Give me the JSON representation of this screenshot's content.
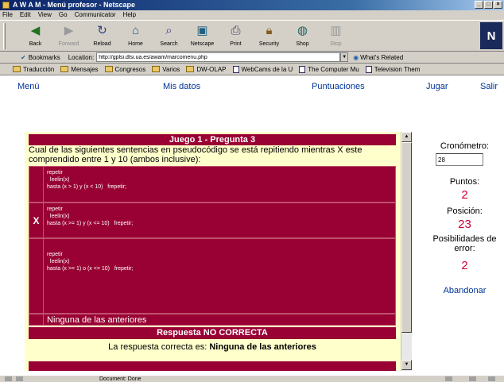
{
  "window": {
    "title": "A W A M - Menú profesor - Netscape"
  },
  "menu": [
    "File",
    "Edit",
    "View",
    "Go",
    "Communicator",
    "Help"
  ],
  "toolbar": [
    {
      "label": "Back",
      "icon": "back-arrow-icon",
      "enabled": true
    },
    {
      "label": "Forward",
      "icon": "forward-arrow-icon",
      "enabled": false
    },
    {
      "label": "Reload",
      "icon": "reload-icon",
      "enabled": true
    },
    {
      "label": "Home",
      "icon": "home-icon",
      "enabled": true
    },
    {
      "label": "Search",
      "icon": "search-icon",
      "enabled": true
    },
    {
      "label": "Netscape",
      "icon": "netscape-icon",
      "enabled": true
    },
    {
      "label": "Print",
      "icon": "print-icon",
      "enabled": true
    },
    {
      "label": "Security",
      "icon": "security-lock-icon",
      "enabled": true
    },
    {
      "label": "Shop",
      "icon": "shop-icon",
      "enabled": true
    },
    {
      "label": "Stop",
      "icon": "stop-icon",
      "enabled": false
    }
  ],
  "location": {
    "bookmarks_label": "Bookmarks",
    "location_label": "Location:",
    "url": "http://gplsi.dlsi.ua.es/awam/marcomenu.php",
    "whats_related": "What's Related"
  },
  "personal_toolbar": [
    {
      "label": "Traducción",
      "icon": "folder"
    },
    {
      "label": "Mensajes",
      "icon": "folder"
    },
    {
      "label": "Congresos",
      "icon": "folder"
    },
    {
      "label": "Varios",
      "icon": "folder"
    },
    {
      "label": "DW-OLAP",
      "icon": "folder"
    },
    {
      "label": "WebCams de la U",
      "icon": "page"
    },
    {
      "label": "The Computer Mu",
      "icon": "page"
    },
    {
      "label": "Television Them",
      "icon": "page"
    }
  ],
  "nav": {
    "menu": "Menú",
    "mis_datos": "Mis datos",
    "puntuaciones": "Puntuaciones",
    "jugar": "Jugar",
    "salir": "Salir"
  },
  "question": {
    "title": "Juego 1 - Pregunta 3",
    "text": "Cual de las siguientes sentencias en pseudocódigo se está repitiendo mientras X este comprendido entre 1 y 10 (ambos inclusive):",
    "options": [
      {
        "mark": "",
        "code": "repetir\n  leelin(x)\nhasta (x > 1) y (x < 10)   frepetir;"
      },
      {
        "mark": "X",
        "code": "repetir\n  leelin(x)\nhasta (x >= 1) y (x <= 10)   frepetir;"
      },
      {
        "mark": "",
        "code": "repetir\n  leelin(x)\nhasta (x >= 1) o (x <= 10)   frepetir;"
      }
    ],
    "option_last": "Ninguna de las anteriores",
    "result": "Respuesta NO CORRECTA",
    "correct_prefix": "La respuesta correcta es:",
    "correct_answer": "Ninguna de las anteriores"
  },
  "side": {
    "cronometro_label": "Cronómetro:",
    "cronometro_value": "28",
    "puntos_label": "Puntos:",
    "puntos_value": "2",
    "posicion_label": "Posición:",
    "posicion_value": "23",
    "posibilidades_label": "Posibilidades de error:",
    "posibilidades_value": "2",
    "abandonar": "Abandonar"
  },
  "status": {
    "text": "Document: Done"
  },
  "colors": {
    "question_bg": "#990033",
    "panel_bg": "#ffffcc",
    "link": "#003399",
    "value": "#cc0033"
  }
}
